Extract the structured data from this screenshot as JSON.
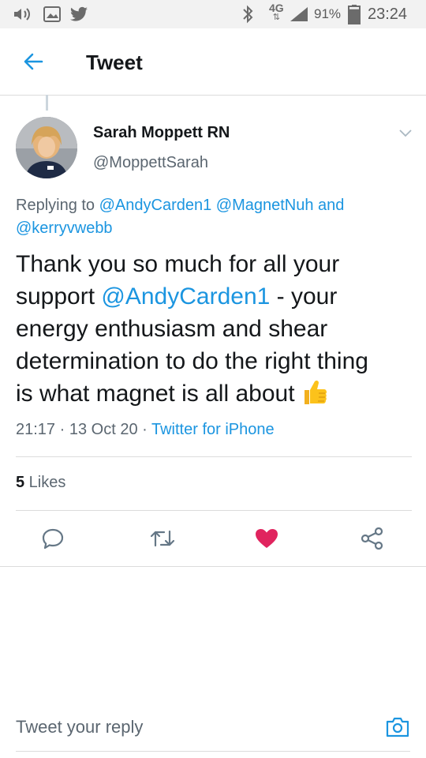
{
  "status_bar": {
    "network_label": "4G",
    "battery_percent": "91%",
    "battery_level": 0.91,
    "time": "23:24",
    "icons": [
      "volume-icon",
      "gallery-icon",
      "twitter-bird-icon",
      "bluetooth-icon",
      "signal-icon",
      "battery-icon"
    ]
  },
  "header": {
    "title": "Tweet",
    "back_icon": "arrow-left-icon"
  },
  "tweet": {
    "author_name": "Sarah Moppett RN",
    "author_handle": "@MoppettSarah",
    "replying_prefix": "Replying to ",
    "replying_mentions": [
      "@AndyCarden1",
      "@MagnetNuh"
    ],
    "replying_and": " and",
    "replying_last": "@kerryvwebb",
    "body": {
      "line1": "Thank you so much for all your",
      "line2_before": "support ",
      "line2_mention": "@AndyCarden1",
      "line2_after": " - your",
      "line3": "energy enthusiasm and shear",
      "line4": "determination to do the right thing",
      "line5": "is what magnet is all about ",
      "emoji": "thumbs-up-icon"
    },
    "time": "21:17",
    "separator": " · ",
    "date": "13 Oct 20",
    "source": "Twitter for iPhone",
    "likes_count": "5",
    "likes_label": " Likes"
  },
  "actions": [
    {
      "name": "reply-button",
      "icon": "comment-icon"
    },
    {
      "name": "retweet-button",
      "icon": "retweet-icon"
    },
    {
      "name": "like-button",
      "icon": "heart-icon",
      "active": true
    },
    {
      "name": "share-button",
      "icon": "share-icon"
    }
  ],
  "reply_bar": {
    "placeholder": "Tweet your reply",
    "camera_icon": "camera-icon"
  },
  "colors": {
    "accent": "#1b95e0",
    "heart": "#e0245e",
    "secondary_text": "#5b6670",
    "divider": "#dcdcdc"
  }
}
